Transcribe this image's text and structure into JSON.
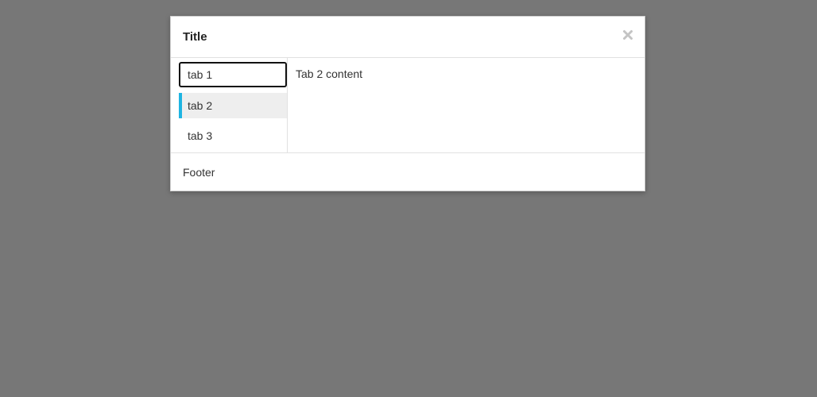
{
  "dialog": {
    "title": "Title",
    "close_icon": "close-icon",
    "tabs": [
      {
        "label": "tab 1",
        "state": "focused"
      },
      {
        "label": "tab 2",
        "state": "selected"
      },
      {
        "label": "tab 3",
        "state": "default"
      }
    ],
    "panel_content": "Tab 2 content",
    "footer": "Footer"
  },
  "colors": {
    "backdrop": "#777777",
    "selected_tab_accent": "#1eb4e2",
    "selected_tab_bg": "#eeeeee",
    "focus_outline": "#111111"
  }
}
